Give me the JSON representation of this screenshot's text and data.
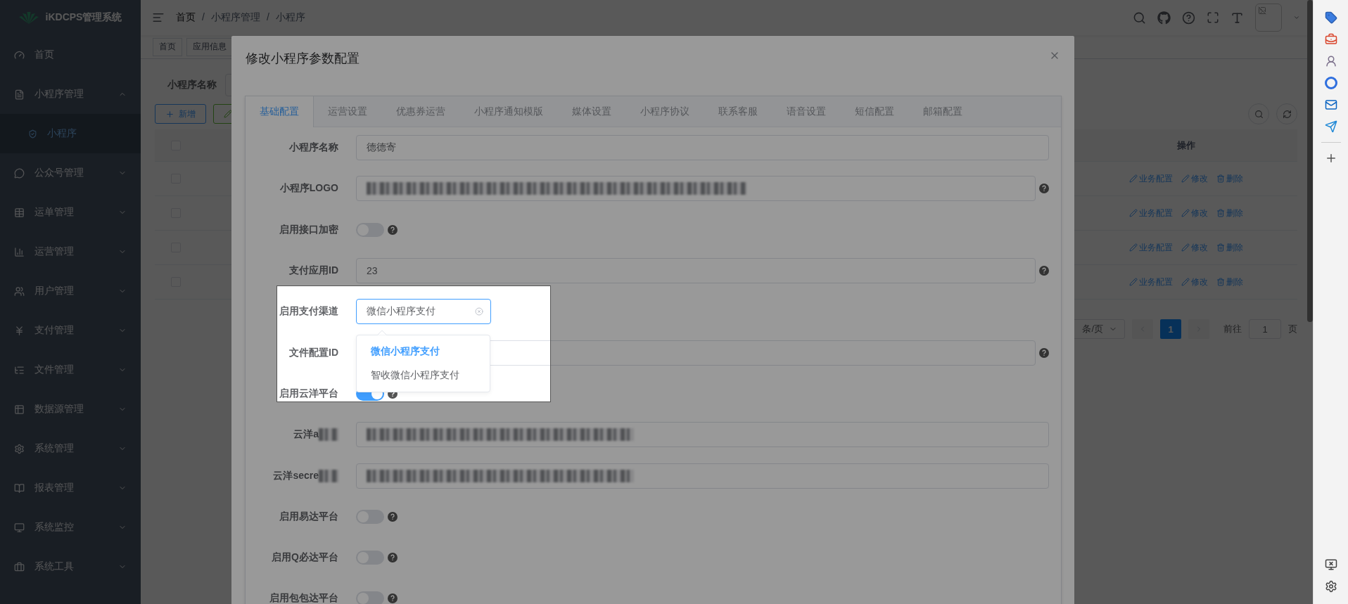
{
  "brand": "iKDCPS管理系统",
  "sidebar": {
    "home": {
      "label": "首页"
    },
    "groups": [
      {
        "label": "小程序管理",
        "expanded": true,
        "children": [
          {
            "label": "小程序",
            "selected": true
          }
        ]
      },
      {
        "label": "公众号管理",
        "expanded": false
      },
      {
        "label": "运单管理",
        "expanded": false
      },
      {
        "label": "运营管理",
        "expanded": false
      },
      {
        "label": "用户管理",
        "expanded": false
      },
      {
        "label": "支付管理",
        "expanded": false
      },
      {
        "label": "文件管理",
        "expanded": false
      },
      {
        "label": "数据源管理",
        "expanded": false
      },
      {
        "label": "系统管理",
        "expanded": false
      },
      {
        "label": "报表管理",
        "expanded": false
      },
      {
        "label": "系统监控",
        "expanded": false
      },
      {
        "label": "系统工具",
        "expanded": false
      }
    ]
  },
  "navbar": {
    "breadcrumb": [
      "首页",
      "小程序管理",
      "小程序"
    ],
    "separator": "/"
  },
  "tags": [
    "首页",
    "应用信息"
  ],
  "search_form": {
    "label": "小程序名称"
  },
  "toolbar": {
    "add_button": "新增"
  },
  "table": {
    "header_checked": false,
    "action_column": "操作",
    "rows": [
      {
        "checked": false,
        "actions": [
          "业务配置",
          "修改",
          "删除"
        ]
      },
      {
        "checked": false,
        "actions": [
          "业务配置",
          "修改",
          "删除"
        ]
      },
      {
        "checked": false,
        "actions": [
          "业务配置",
          "修改",
          "删除"
        ]
      },
      {
        "checked": false,
        "actions": [
          "业务配置",
          "修改",
          "删除"
        ]
      }
    ]
  },
  "pagination": {
    "page_size": "条/页",
    "pages": [
      {
        "label": "1",
        "selected": true
      }
    ],
    "goto_label": "前往",
    "goto_value": "1",
    "goto_suffix": "页"
  },
  "modal": {
    "title": "修改小程序参数配置",
    "tabs": [
      {
        "label": "基础配置",
        "selected": true
      },
      {
        "label": "运营设置",
        "selected": false
      },
      {
        "label": "优惠券运营",
        "selected": false
      },
      {
        "label": "小程序通知模版",
        "selected": false
      },
      {
        "label": "媒体设置",
        "selected": false
      },
      {
        "label": "小程序协议",
        "selected": false
      },
      {
        "label": "联系客服",
        "selected": false
      },
      {
        "label": "语音设置",
        "selected": false
      },
      {
        "label": "短信配置",
        "selected": false
      },
      {
        "label": "邮箱配置",
        "selected": false
      }
    ],
    "form": {
      "rows": [
        {
          "kind": "input",
          "label": "小程序名称",
          "value": "德德寄",
          "help": false
        },
        {
          "kind": "input",
          "label": "小程序LOGO",
          "value_redacted": true,
          "help": true
        },
        {
          "kind": "switch",
          "label": "启用接口加密",
          "on": false,
          "help": true
        },
        {
          "kind": "input",
          "label": "支付应用ID",
          "value": "23",
          "help": true
        },
        {
          "kind": "select",
          "label": "启用支付渠道",
          "value": "微信小程序支付",
          "options": [
            {
              "label": "微信小程序支付",
              "selected": true
            },
            {
              "label": "智收微信小程序支付",
              "selected": false
            }
          ]
        },
        {
          "kind": "input",
          "label": "文件配置ID",
          "help": true
        },
        {
          "kind": "switch",
          "label": "启用云洋平台",
          "on": true,
          "help": true
        },
        {
          "kind": "input",
          "label": "云洋a",
          "label_redacted": true,
          "value_redacted": true,
          "help": false
        },
        {
          "kind": "input",
          "label": "云洋secre",
          "label_redacted": true,
          "value_redacted": true,
          "help": false
        },
        {
          "kind": "switch",
          "label": "启用易达平台",
          "on": false,
          "help": true
        },
        {
          "kind": "switch",
          "label": "启用Q必达平台",
          "on": false,
          "help": true
        },
        {
          "kind": "switch",
          "label": "启用包包达平台",
          "on": false,
          "help": true
        }
      ]
    }
  }
}
